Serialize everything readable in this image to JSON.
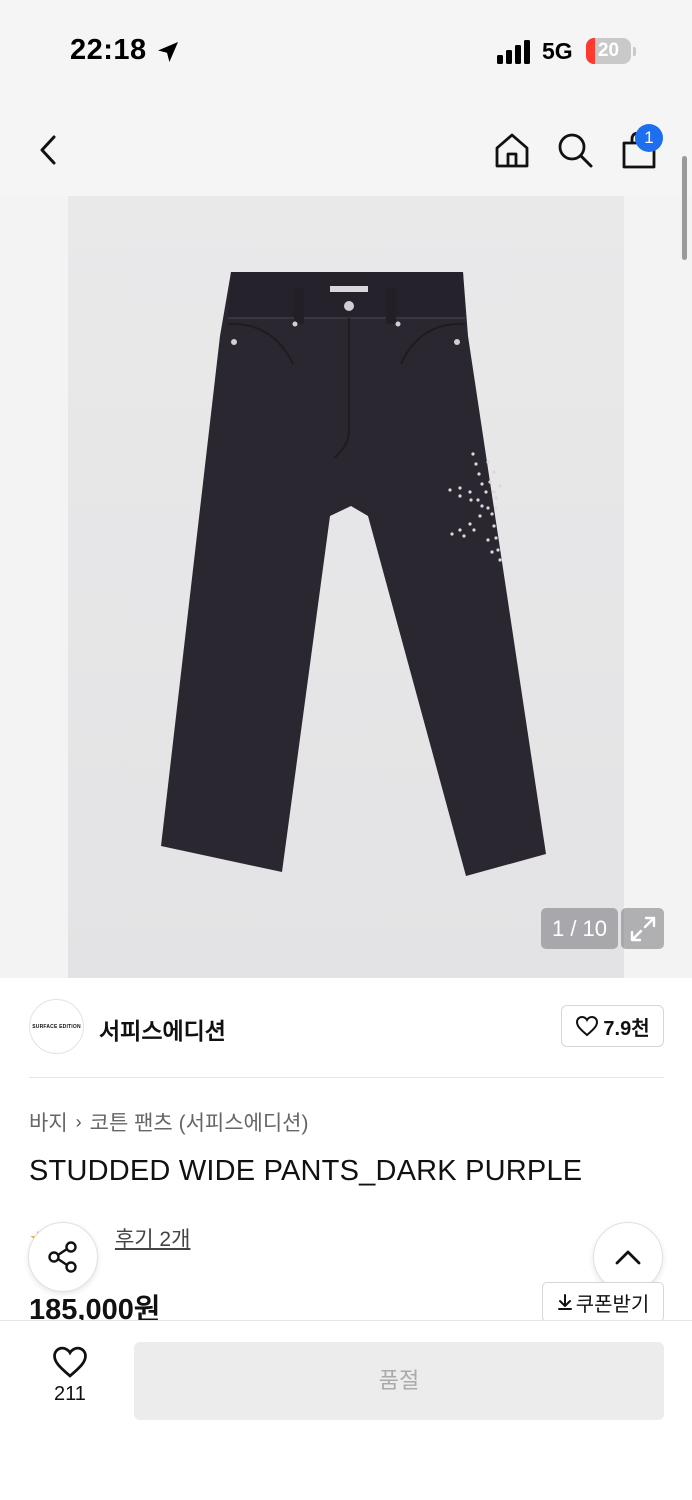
{
  "status_bar": {
    "time": "22:18",
    "network": "5G",
    "battery_level": "20",
    "battery_fraction": 0.2,
    "location_icon": "location-arrow-icon",
    "signal_icon": "signal-bars-icon"
  },
  "nav": {
    "back_icon": "chevron-left-icon",
    "home_icon": "home-icon",
    "search_icon": "search-icon",
    "cart_icon": "shopping-bag-icon",
    "cart_badge": "1"
  },
  "gallery": {
    "counter": "1 / 10",
    "expand_icon": "expand-icon",
    "image_label": "dark purple wide pants with studded flower"
  },
  "brand": {
    "logo_text": "SURFACE EDITION",
    "name": "서피스에디션",
    "likes": "7.9천",
    "heart_icon": "heart-outline-icon"
  },
  "product": {
    "breadcrumb": [
      "바지",
      "코튼 팬츠 (서피스에디션)"
    ],
    "title": "STUDDED WIDE PANTS_DARK PURPLE",
    "review_link": "후기 2개",
    "price": "185,000원",
    "coupon_label": "쿠폰받기"
  },
  "floating": {
    "share_icon": "share-icon",
    "top_icon": "chevron-up-icon"
  },
  "bottom_bar": {
    "wish_count": "211",
    "buy_label": "품절"
  },
  "colors": {
    "accent_blue": "#1e6ff0",
    "battery_red": "#ff3b30",
    "pants": "#2b2731"
  }
}
